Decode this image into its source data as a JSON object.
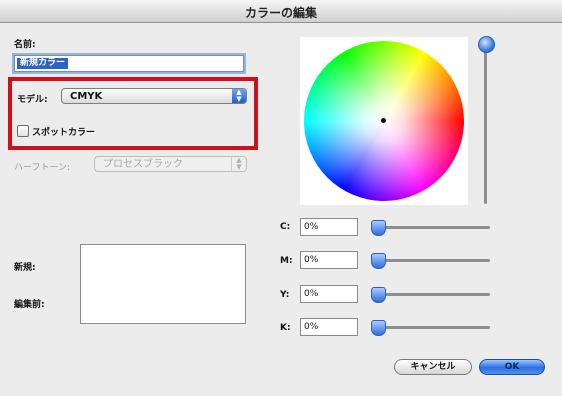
{
  "window": {
    "title": "カラーの編集"
  },
  "name_field": {
    "label": "名前:",
    "value": "新規カラー"
  },
  "model": {
    "label": "モデル:",
    "value": "CMYK"
  },
  "spot_color": {
    "label": "スポットカラー",
    "checked": false
  },
  "halftone": {
    "label": "ハーフトーン:",
    "value": "プロセスブラック",
    "enabled": false
  },
  "swatch": {
    "new_label": "新規:",
    "before_label": "編集前:"
  },
  "cmyk": [
    {
      "label": "C:",
      "value": "0%"
    },
    {
      "label": "M:",
      "value": "0%"
    },
    {
      "label": "Y:",
      "value": "0%"
    },
    {
      "label": "K:",
      "value": "0%"
    }
  ],
  "buttons": {
    "cancel": "キャンセル",
    "ok": "OK"
  },
  "colors": {
    "highlight": "#d0101a",
    "accent": "#2b6fe0"
  },
  "icons": {
    "popup_arrow": "updown-arrows-icon",
    "brightness_slider": "slider-knob-icon"
  }
}
